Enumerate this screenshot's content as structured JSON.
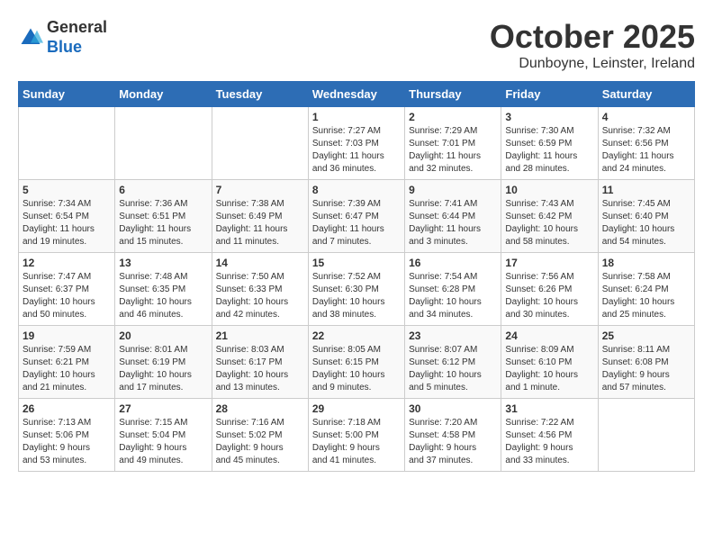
{
  "header": {
    "logo_line1": "General",
    "logo_line2": "Blue",
    "month": "October 2025",
    "location": "Dunboyne, Leinster, Ireland"
  },
  "weekdays": [
    "Sunday",
    "Monday",
    "Tuesday",
    "Wednesday",
    "Thursday",
    "Friday",
    "Saturday"
  ],
  "weeks": [
    [
      {
        "day": "",
        "info": ""
      },
      {
        "day": "",
        "info": ""
      },
      {
        "day": "",
        "info": ""
      },
      {
        "day": "1",
        "info": "Sunrise: 7:27 AM\nSunset: 7:03 PM\nDaylight: 11 hours\nand 36 minutes."
      },
      {
        "day": "2",
        "info": "Sunrise: 7:29 AM\nSunset: 7:01 PM\nDaylight: 11 hours\nand 32 minutes."
      },
      {
        "day": "3",
        "info": "Sunrise: 7:30 AM\nSunset: 6:59 PM\nDaylight: 11 hours\nand 28 minutes."
      },
      {
        "day": "4",
        "info": "Sunrise: 7:32 AM\nSunset: 6:56 PM\nDaylight: 11 hours\nand 24 minutes."
      }
    ],
    [
      {
        "day": "5",
        "info": "Sunrise: 7:34 AM\nSunset: 6:54 PM\nDaylight: 11 hours\nand 19 minutes."
      },
      {
        "day": "6",
        "info": "Sunrise: 7:36 AM\nSunset: 6:51 PM\nDaylight: 11 hours\nand 15 minutes."
      },
      {
        "day": "7",
        "info": "Sunrise: 7:38 AM\nSunset: 6:49 PM\nDaylight: 11 hours\nand 11 minutes."
      },
      {
        "day": "8",
        "info": "Sunrise: 7:39 AM\nSunset: 6:47 PM\nDaylight: 11 hours\nand 7 minutes."
      },
      {
        "day": "9",
        "info": "Sunrise: 7:41 AM\nSunset: 6:44 PM\nDaylight: 11 hours\nand 3 minutes."
      },
      {
        "day": "10",
        "info": "Sunrise: 7:43 AM\nSunset: 6:42 PM\nDaylight: 10 hours\nand 58 minutes."
      },
      {
        "day": "11",
        "info": "Sunrise: 7:45 AM\nSunset: 6:40 PM\nDaylight: 10 hours\nand 54 minutes."
      }
    ],
    [
      {
        "day": "12",
        "info": "Sunrise: 7:47 AM\nSunset: 6:37 PM\nDaylight: 10 hours\nand 50 minutes."
      },
      {
        "day": "13",
        "info": "Sunrise: 7:48 AM\nSunset: 6:35 PM\nDaylight: 10 hours\nand 46 minutes."
      },
      {
        "day": "14",
        "info": "Sunrise: 7:50 AM\nSunset: 6:33 PM\nDaylight: 10 hours\nand 42 minutes."
      },
      {
        "day": "15",
        "info": "Sunrise: 7:52 AM\nSunset: 6:30 PM\nDaylight: 10 hours\nand 38 minutes."
      },
      {
        "day": "16",
        "info": "Sunrise: 7:54 AM\nSunset: 6:28 PM\nDaylight: 10 hours\nand 34 minutes."
      },
      {
        "day": "17",
        "info": "Sunrise: 7:56 AM\nSunset: 6:26 PM\nDaylight: 10 hours\nand 30 minutes."
      },
      {
        "day": "18",
        "info": "Sunrise: 7:58 AM\nSunset: 6:24 PM\nDaylight: 10 hours\nand 25 minutes."
      }
    ],
    [
      {
        "day": "19",
        "info": "Sunrise: 7:59 AM\nSunset: 6:21 PM\nDaylight: 10 hours\nand 21 minutes."
      },
      {
        "day": "20",
        "info": "Sunrise: 8:01 AM\nSunset: 6:19 PM\nDaylight: 10 hours\nand 17 minutes."
      },
      {
        "day": "21",
        "info": "Sunrise: 8:03 AM\nSunset: 6:17 PM\nDaylight: 10 hours\nand 13 minutes."
      },
      {
        "day": "22",
        "info": "Sunrise: 8:05 AM\nSunset: 6:15 PM\nDaylight: 10 hours\nand 9 minutes."
      },
      {
        "day": "23",
        "info": "Sunrise: 8:07 AM\nSunset: 6:12 PM\nDaylight: 10 hours\nand 5 minutes."
      },
      {
        "day": "24",
        "info": "Sunrise: 8:09 AM\nSunset: 6:10 PM\nDaylight: 10 hours\nand 1 minute."
      },
      {
        "day": "25",
        "info": "Sunrise: 8:11 AM\nSunset: 6:08 PM\nDaylight: 9 hours\nand 57 minutes."
      }
    ],
    [
      {
        "day": "26",
        "info": "Sunrise: 7:13 AM\nSunset: 5:06 PM\nDaylight: 9 hours\nand 53 minutes."
      },
      {
        "day": "27",
        "info": "Sunrise: 7:15 AM\nSunset: 5:04 PM\nDaylight: 9 hours\nand 49 minutes."
      },
      {
        "day": "28",
        "info": "Sunrise: 7:16 AM\nSunset: 5:02 PM\nDaylight: 9 hours\nand 45 minutes."
      },
      {
        "day": "29",
        "info": "Sunrise: 7:18 AM\nSunset: 5:00 PM\nDaylight: 9 hours\nand 41 minutes."
      },
      {
        "day": "30",
        "info": "Sunrise: 7:20 AM\nSunset: 4:58 PM\nDaylight: 9 hours\nand 37 minutes."
      },
      {
        "day": "31",
        "info": "Sunrise: 7:22 AM\nSunset: 4:56 PM\nDaylight: 9 hours\nand 33 minutes."
      },
      {
        "day": "",
        "info": ""
      }
    ]
  ]
}
